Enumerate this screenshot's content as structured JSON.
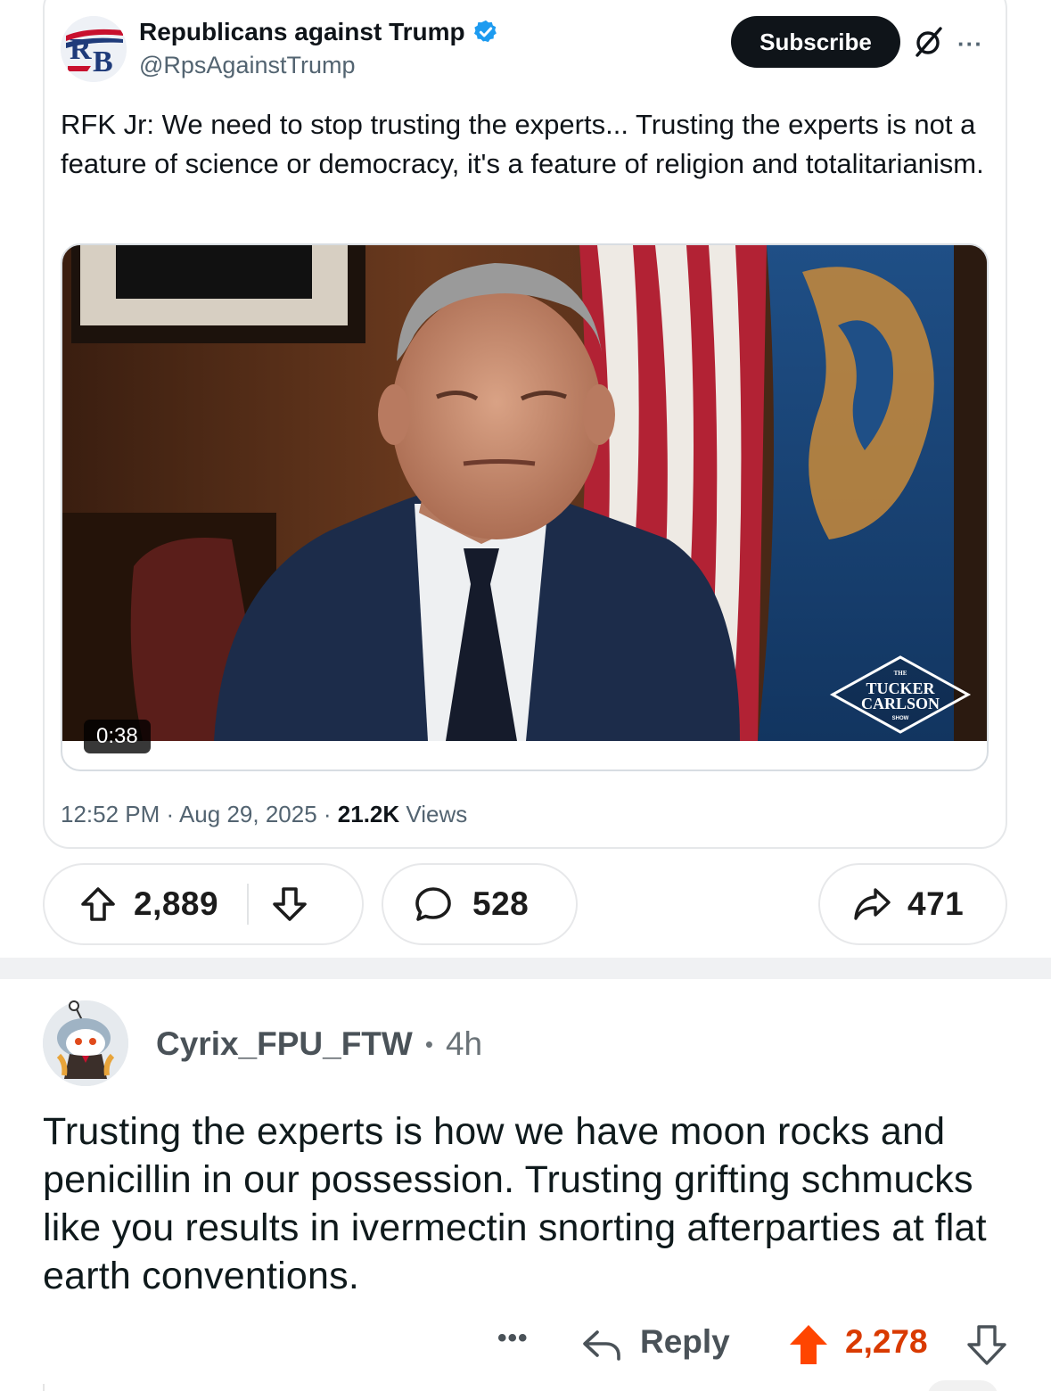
{
  "tweet": {
    "author_name": "Republicans against Trump",
    "author_handle": "@RpsAgainstTrump",
    "avatar_text": "RB",
    "subscribe_label": "Subscribe",
    "more_label": "···",
    "text": "RFK Jr: We need to stop trusting the experts... Trusting the experts is not a feature of science or democracy, it's a feature of religion and totalitarianism.",
    "video": {
      "duration": "0:38",
      "watermark_lines": [
        "THE",
        "TUCKER",
        "CARLSON",
        "SHOW"
      ]
    },
    "time": "12:52 PM",
    "date": "Aug 29, 2025",
    "views_count": "21.2K",
    "views_label": "Views",
    "separator": " · "
  },
  "post_actions": {
    "upvotes": "2,889",
    "comments": "528",
    "shares": "471"
  },
  "comment": {
    "username": "Cyrix_FPU_FTW",
    "dot": "•",
    "age": "4h",
    "body": "Trusting the experts is how we have moon rocks and penicillin in our possession. Trusting grifting schmucks like you results in ivermectin snorting afterparties at flat earth conventions.",
    "more_label": "•••",
    "reply_label": "Reply",
    "score": "2,278"
  },
  "colors": {
    "verified_blue": "#1d9bf0",
    "upvoted_orange": "#d93a00",
    "subscribe_bg": "#0f1419"
  },
  "icons": [
    "verified-badge-icon",
    "grok-icon",
    "more-icon",
    "upvote-icon",
    "downvote-icon",
    "comment-bubble-icon",
    "share-icon",
    "reply-arrow-icon"
  ]
}
